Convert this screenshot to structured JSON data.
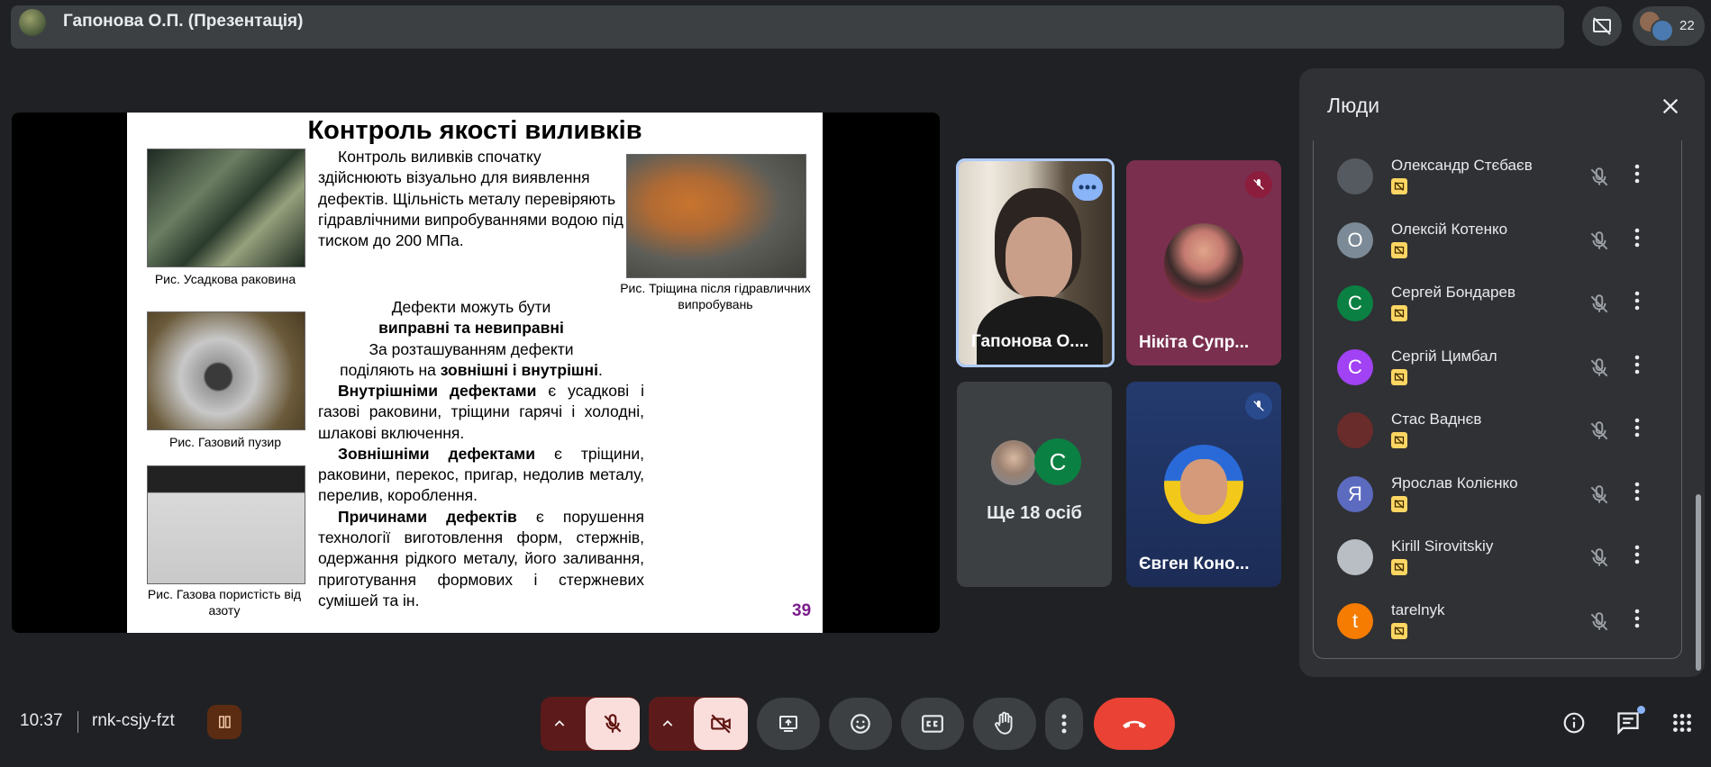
{
  "topbar": {
    "presenter_title": "Гапонова О.П. (Презентація)",
    "participant_count": "22"
  },
  "slide": {
    "title": "Контроль якості виливків",
    "para1": "Контроль виливків спочатку здійснюють візуально для виявлення дефектів. Щільність металу перевіряють  гідравлічними випробуваннями водою під тиском до 200 МПа.",
    "defects_line1": "Дефекти можуть бути",
    "defects_line2": "виправні та невиправні",
    "defects_line3": "За розташуванням дефекти",
    "defects_line4a": "поділяють на ",
    "defects_line4b": "зовнішні і внутрішні",
    "defects_line4c": ".",
    "internal_bold": "Внутрішніми дефектами",
    "internal_rest": " є усадкові і газові раковини, тріщини гарячі і холодні, шлакові включення.",
    "external_bold": "Зовнішніми дефектами",
    "external_rest": " є тріщини, раковини, перекос, пригар, недолив металу, перелив, короблення.",
    "causes_bold": "Причинами дефектів",
    "causes_rest": " є порушення технології виготовлення форм, стержнів, одержання рідкого металу, його заливання, приготування формових і стержневих сумішей та ін.",
    "cap1": "Рис. Усадкова раковина",
    "cap2": "Рис. Газовий пузир",
    "cap3": "Рис. Газова пористість від азоту",
    "cap4": "Рис. Тріщина після гідравличних випробувань",
    "page_number": "39"
  },
  "tiles": {
    "t1_name": "Гапонова О....",
    "t2_name": "Нікіта Супр...",
    "t3_more": "Ще 18 осіб",
    "t3_avatar_letter": "С",
    "t4_name": "Євген Коно..."
  },
  "people_panel": {
    "title": "Люди",
    "people": [
      {
        "name": "Олександр Стєбаєв",
        "initial": "",
        "color": "#555a60"
      },
      {
        "name": "Олексій Котенко",
        "initial": "О",
        "color": "#7b8a96"
      },
      {
        "name": "Сергей Бондарев",
        "initial": "С",
        "color": "#0b8043"
      },
      {
        "name": "Сергій Цимбал",
        "initial": "С",
        "color": "#a142f4"
      },
      {
        "name": "Стас Ваднєв",
        "initial": "",
        "color": "#6a2b2b"
      },
      {
        "name": "Ярослав Колієнко",
        "initial": "Я",
        "color": "#5c6bc0"
      },
      {
        "name": "Kirill Sirovitskiy",
        "initial": "",
        "color": "#b8bec4"
      },
      {
        "name": "tarelnyk",
        "initial": "t",
        "color": "#f57c00"
      }
    ]
  },
  "bottom": {
    "time": "10:37",
    "meeting_code": "rnk-csjy-fzt"
  }
}
